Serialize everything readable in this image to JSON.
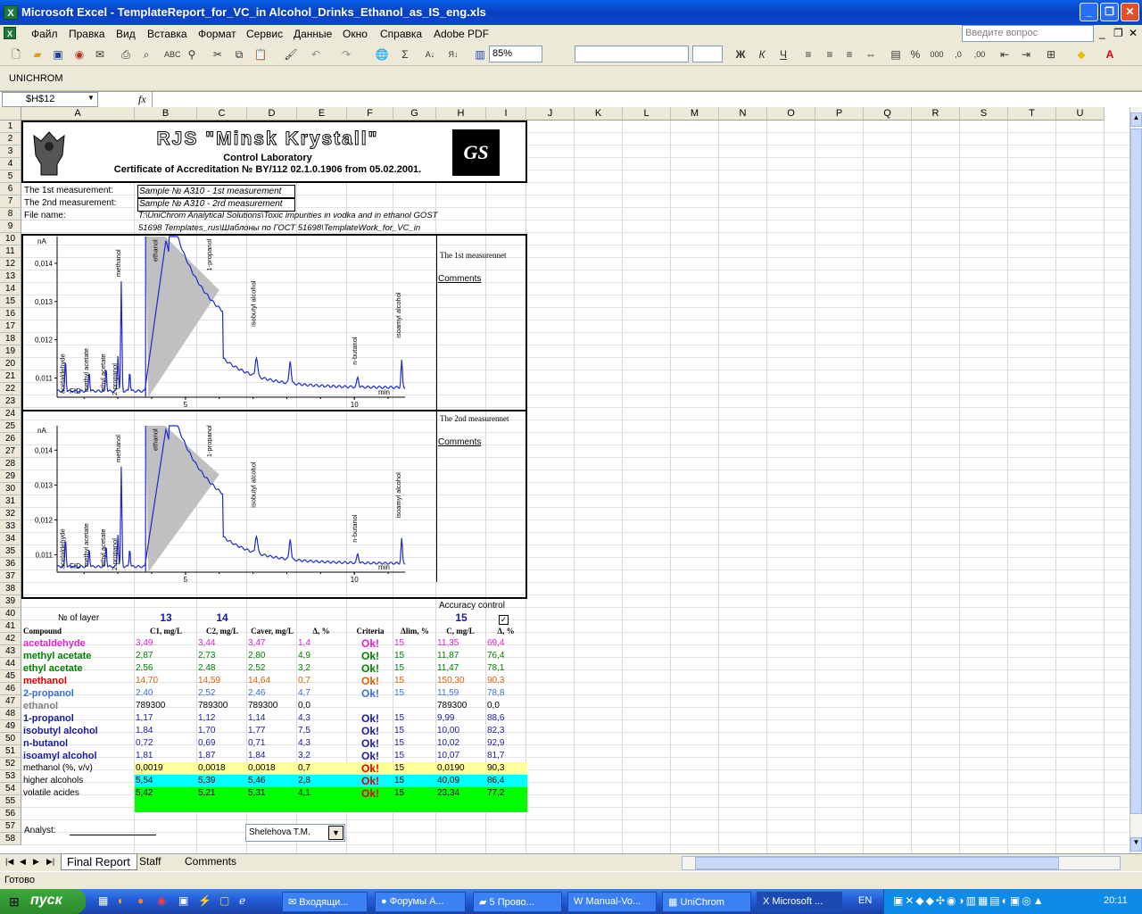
{
  "window": {
    "title": "Microsoft Excel - TemplateReport_for_VC_in Alcohol_Drinks_Ethanol_as_IS_eng.xls"
  },
  "menu": [
    "Файл",
    "Правка",
    "Вид",
    "Вставка",
    "Формат",
    "Сервис",
    "Данные",
    "Окно",
    "Справка",
    "Adobe PDF"
  ],
  "help_placeholder": "Введите вопрос",
  "zoom": "85%",
  "toolbar2_label": "UNICHROM",
  "namebox": "$H$12",
  "fx": "fx",
  "columns": [
    "A",
    "B",
    "C",
    "D",
    "E",
    "F",
    "G",
    "H",
    "I",
    "J",
    "K",
    "L",
    "M",
    "N",
    "O",
    "P",
    "Q",
    "R",
    "S",
    "T",
    "U"
  ],
  "rows": [
    "1",
    "2",
    "3",
    "4",
    "5",
    "6",
    "7",
    "8",
    "9",
    "10",
    "11",
    "12",
    "13",
    "14",
    "15",
    "16",
    "17",
    "18",
    "19",
    "20",
    "21",
    "22",
    "23",
    "24",
    "25",
    "26",
    "27",
    "28",
    "29",
    "30",
    "31",
    "32",
    "33",
    "34",
    "35",
    "36",
    "37",
    "38",
    "39",
    "40",
    "41",
    "42",
    "43",
    "44",
    "45",
    "46",
    "47",
    "48",
    "49",
    "50",
    "51",
    "52",
    "53",
    "54",
    "55",
    "56",
    "57",
    "58"
  ],
  "header": {
    "company": "RJS \"Minsk Krystall\"",
    "lab": "Control Laboratory",
    "cert": "Certificate of Accreditation № BY/112 02.1.0.1906 from 05.02.2001.",
    "logo": "GS"
  },
  "info": {
    "m1_label": "The 1st  measurement:",
    "m1_value": "Sample № A310 - 1st measurement",
    "m2_label": "The 2nd measurement:",
    "m2_value": "Sample № A310 - 2rd measurement",
    "file_label": "File name:",
    "file_line1": "T:\\UniChrom Analytical Solutions\\Toxic impurities in vodka and in ethanol GOST",
    "file_line2": "51698 Templates_rus\\Шаблоны по ГОСТ 51698\\TemplateWork_for_VC_in"
  },
  "chart1": {
    "side_title": "The 1st measurennet",
    "comments": "Comments",
    "yunit": "nA",
    "xunit": "min",
    "detector": "FID",
    "yticks": [
      "0,014",
      "0,013",
      "0,012",
      "0,011"
    ],
    "xticks": [
      "5",
      "10"
    ],
    "peaks": [
      "acetaldehyde",
      "methyl acetate",
      "ethyl acetate",
      "2-propanol",
      "methanol",
      "ethanol",
      "1-propanol",
      "isobutyl alcohol",
      "n-butanol",
      "isoamyl alcohol"
    ]
  },
  "chart2": {
    "side_title": "The 2nd measurennet",
    "comments": "Comments",
    "yunit": "nA",
    "xunit": "min",
    "detector": "FID",
    "yticks": [
      "0,014",
      "0,013",
      "0,012",
      "0,011"
    ],
    "xticks": [
      "5",
      "10"
    ],
    "peaks": [
      "acetaldehyde",
      "methyl acetate",
      "ethyl acetate",
      "2-propanol",
      "methanol",
      "ethanol",
      "1-propanol",
      "isobutyl alcohol",
      "n-butanol",
      "isoamyl alcohol"
    ]
  },
  "table": {
    "accuracy_control": "Accuracy control",
    "layer_label": "№ of layer",
    "layer1": "13",
    "layer2": "14",
    "layer3": "15",
    "headers": [
      "Compound",
      "C1, mg/L",
      "C2,  mg/L",
      "Caver, mg/L",
      "Δ,  %",
      "Criteria",
      "Δlim, %",
      "C, mg/L",
      "Δ,  %"
    ],
    "rows": [
      {
        "name": "acetaldehyde",
        "c1": "3,49",
        "c2": "3,44",
        "cav": "3,47",
        "d": "1,4",
        "crit": "Ok!",
        "lim": "15",
        "c": "11,35",
        "d2": "69,4",
        "color": "#e020d0"
      },
      {
        "name": "methyl acetate",
        "c1": "2,87",
        "c2": "2,73",
        "cav": "2,80",
        "d": "4,9",
        "crit": "Ok!",
        "lim": "15",
        "c": "11,87",
        "d2": "76,4",
        "color": "#008000"
      },
      {
        "name": "ethyl acetate",
        "c1": "2,56",
        "c2": "2,48",
        "cav": "2,52",
        "d": "3,2",
        "crit": "Ok!",
        "lim": "15",
        "c": "11,47",
        "d2": "78,1",
        "color": "#008000"
      },
      {
        "name": "methanol",
        "c1": "14,70",
        "c2": "14,59",
        "cav": "14,64",
        "d": "0,7",
        "crit": "Ok!",
        "lim": "15",
        "c": "150,30",
        "d2": "90,3",
        "color": "#e06000",
        "namecolor": "#e00000"
      },
      {
        "name": "2-propanol",
        "c1": "2,40",
        "c2": "2,52",
        "cav": "2,46",
        "d": "4,7",
        "crit": "Ok!",
        "lim": "15",
        "c": "11,59",
        "d2": "78,8",
        "color": "#3a6ee0"
      },
      {
        "name": "ethanol",
        "c1": "789300",
        "c2": "789300",
        "cav": "789300",
        "d": "0,0",
        "crit": "",
        "lim": "",
        "c": "789300",
        "d2": "0,0",
        "color": "#000000",
        "namecolor": "#808080"
      },
      {
        "name": "1-propanol",
        "c1": "1,17",
        "c2": "1,12",
        "cav": "1,14",
        "d": "4,3",
        "crit": "Ok!",
        "lim": "15",
        "c": "9,99",
        "d2": "88,6",
        "color": "#1a1aa0"
      },
      {
        "name": "isobutyl alcohol",
        "c1": "1,84",
        "c2": "1,70",
        "cav": "1,77",
        "d": "7,5",
        "crit": "Ok!",
        "lim": "15",
        "c": "10,00",
        "d2": "82,3",
        "color": "#1a1aa0"
      },
      {
        "name": "n-butanol",
        "c1": "0,72",
        "c2": "0,69",
        "cav": "0,71",
        "d": "4,3",
        "crit": "Ok!",
        "lim": "15",
        "c": "10,02",
        "d2": "92,9",
        "color": "#1a1aa0"
      },
      {
        "name": "isoamyl alcohol",
        "c1": "1,81",
        "c2": "1,87",
        "cav": "1,84",
        "d": "3,2",
        "crit": "Ok!",
        "lim": "15",
        "c": "10,07",
        "d2": "81,7",
        "color": "#1a1aa0"
      },
      {
        "name": "methanol (%, v/v)",
        "c1": "0,0019",
        "c2": "0,0018",
        "cav": "0,0018",
        "d": "0,7",
        "crit": "Ok!",
        "lim": "15",
        "c": "0,0190",
        "d2": "90,3",
        "color": "#000000",
        "bg": "#ffff99",
        "plain": true
      },
      {
        "name": "higher alcohols",
        "c1": "5,54",
        "c2": "5,39",
        "cav": "5,46",
        "d": "2,8",
        "crit": "Ok!",
        "lim": "15",
        "c": "40,09",
        "d2": "86,4",
        "color": "#000000",
        "bg": "#00ffff",
        "plain": true
      },
      {
        "name": "volatile acides",
        "c1": "5,42",
        "c2": "5,21",
        "cav": "5,31",
        "d": "4,1",
        "crit": "Ok!",
        "lim": "15",
        "c": "23,34",
        "d2": "77,2",
        "color": "#000000",
        "bg": "#00ff00",
        "plain": true
      }
    ],
    "analyst_label": "Analyst:",
    "analyst_value": "Shelehova T.M."
  },
  "sheets": [
    "Final Report",
    "Staff",
    "Comments"
  ],
  "status": "Готово",
  "taskbar": {
    "start": "пуск",
    "tasks": [
      "Входящи...",
      "Форумы А...",
      "5 Прово...",
      "Manual-Vo...",
      "UniChrom",
      "Microsoft ..."
    ],
    "lang": "EN",
    "time": "20:11"
  }
}
